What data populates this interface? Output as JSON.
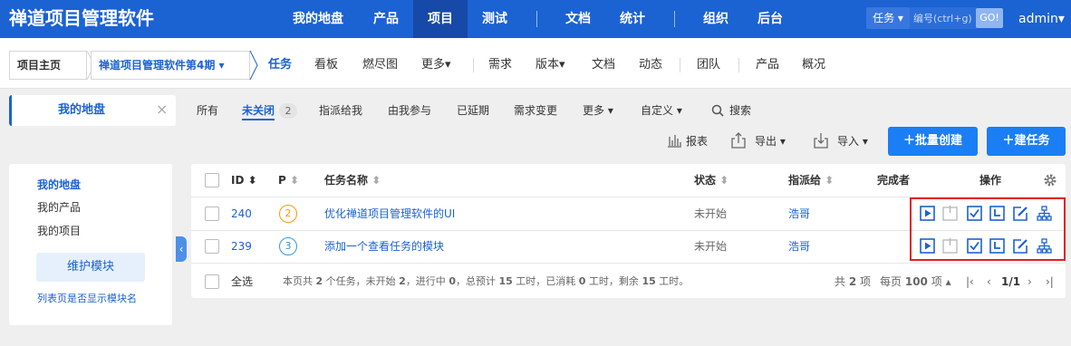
{
  "app_title": "禅道项目管理软件",
  "nav": {
    "items": [
      "我的地盘",
      "产品",
      "项目",
      "测试",
      "文档",
      "统计",
      "组织",
      "后台"
    ],
    "active": "项目",
    "search_type": "任务",
    "search_placeholder": "编号(ctrl+g)",
    "go_label": "GO!",
    "user": "admin"
  },
  "breadcrumb": {
    "home": "项目主页",
    "project": "禅道项目管理软件第4期"
  },
  "subnav": [
    "任务",
    "看板",
    "燃尽图",
    "更多",
    "需求",
    "版本",
    "文档",
    "动态",
    "团队",
    "产品",
    "概况"
  ],
  "sidebar": {
    "title": "我的地盘",
    "items": [
      "我的地盘",
      "我的产品",
      "我的项目"
    ],
    "maintain_label": "维护模块",
    "note": "列表页是否显示模块名"
  },
  "filters": {
    "all": "所有",
    "open": "未关闭",
    "open_count": "2",
    "assigned": "指派给我",
    "involved": "由我参与",
    "delayed": "已延期",
    "story_changed": "需求变更",
    "more": "更多",
    "custom": "自定义",
    "search": "搜索"
  },
  "toolbar": {
    "report": "报表",
    "export": "导出",
    "import": "导入",
    "batch_create": "批量创建",
    "create": "建任务"
  },
  "table": {
    "headers": {
      "id": "ID",
      "pri": "P",
      "name": "任务名称",
      "status": "状态",
      "assigned": "指派给",
      "finished_by": "完成者",
      "actions": "操作"
    },
    "rows": [
      {
        "id": "240",
        "pri": "2",
        "name": "优化禅道项目管理软件的UI",
        "status": "未开始",
        "assigned": "浩哥"
      },
      {
        "id": "239",
        "pri": "3",
        "name": "添加一个查看任务的模块",
        "status": "未开始",
        "assigned": "浩哥"
      }
    ],
    "select_all": "全选",
    "summary_parts": [
      "本页共 ",
      "2",
      " 个任务，未开始 ",
      "2",
      "，进行中 ",
      "0",
      "，总预计 ",
      "15",
      " 工时，已消耗 ",
      "0",
      " 工时，剩余 ",
      "15",
      " 工时。"
    ],
    "pager": {
      "total_prefix": "共",
      "total": "2",
      "total_suffix": "项",
      "per_prefix": "每页",
      "per_page": "100",
      "per_suffix": "项",
      "page": "1/1"
    }
  },
  "colors": {
    "primary": "#1b62d3",
    "pri2": "#f39c12",
    "pri3": "#3399dd",
    "highlight": "#e02020"
  }
}
